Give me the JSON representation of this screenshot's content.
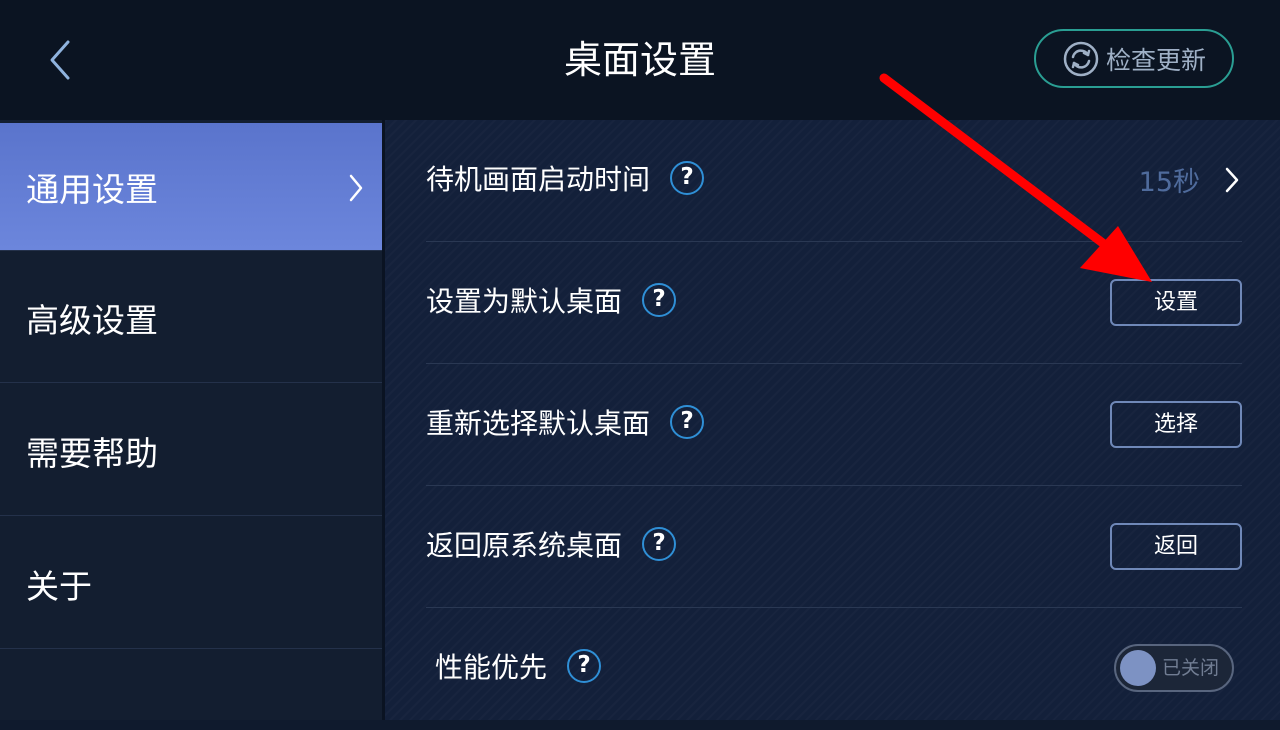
{
  "header": {
    "title": "桌面设置",
    "back_icon": "chevron-left-icon",
    "update_button": {
      "label": "检查更新",
      "icon": "refresh-icon"
    }
  },
  "sidebar": {
    "items": [
      {
        "label": "通用设置",
        "active": true
      },
      {
        "label": "高级设置",
        "active": false
      },
      {
        "label": "需要帮助",
        "active": false
      },
      {
        "label": "关于",
        "active": false
      }
    ]
  },
  "main": {
    "rows": [
      {
        "label": "待机画面启动时间",
        "help": "?",
        "value": "15秒"
      },
      {
        "label": "设置为默认桌面",
        "help": "?",
        "button": "设置"
      },
      {
        "label": "重新选择默认桌面",
        "help": "?",
        "button": "选择"
      },
      {
        "label": "返回原系统桌面",
        "help": "?",
        "button": "返回"
      },
      {
        "label": "性能优先",
        "help": "?",
        "toggle": "已关闭",
        "toggle_on": false
      }
    ]
  },
  "colors": {
    "header_bg": "#0b1422",
    "sidebar_bg": "#131e30",
    "sidebar_active": "#6c86dc",
    "accent_teal": "#2a9e93",
    "help_blue": "#2f8fd6",
    "annotation_red": "#ff0000"
  }
}
